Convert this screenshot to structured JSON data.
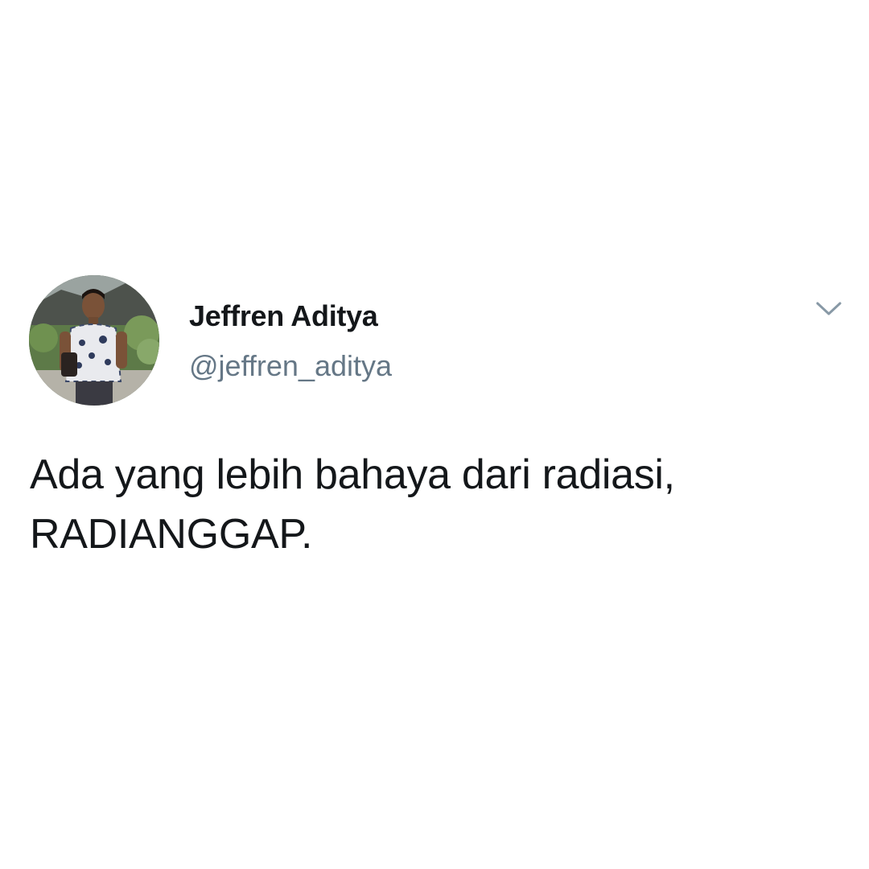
{
  "tweet": {
    "author": {
      "display_name": "Jeffren Aditya",
      "handle": "@jeffren_aditya",
      "avatar": "profile-photo"
    },
    "text": "Ada yang lebih bahaya dari radiasi, RADIANGGAP.",
    "menu_icon": "chevron-down-icon"
  }
}
